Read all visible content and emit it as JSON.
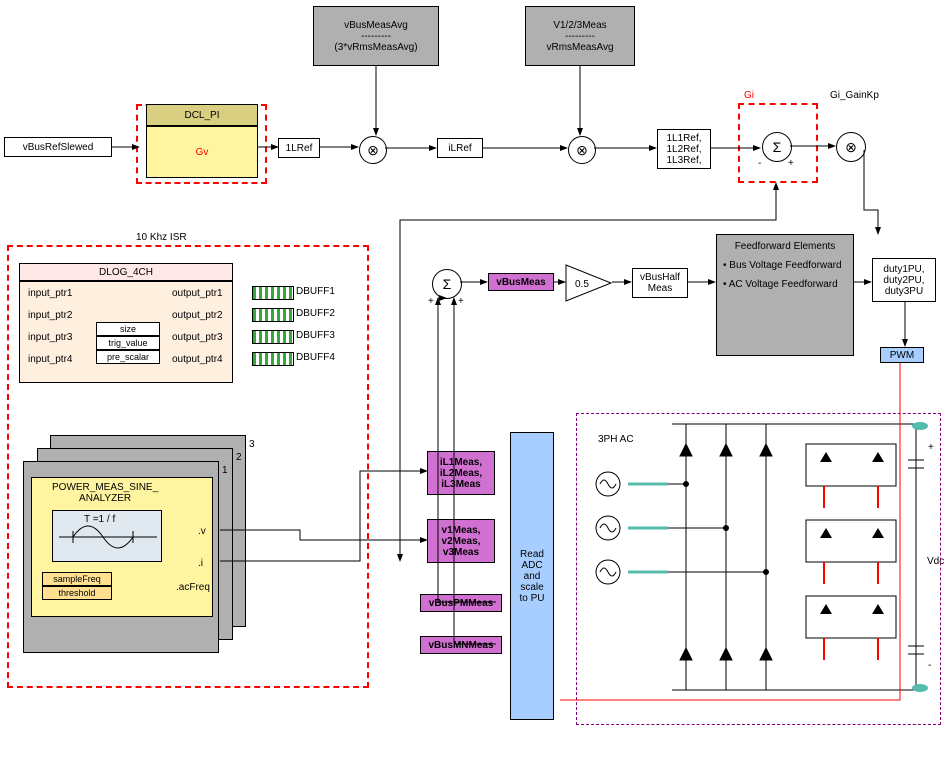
{
  "top": {
    "vBusRefSlewed": "vBusRefSlewed",
    "dclpi": "DCL_PI",
    "gv": "Gv",
    "gvLabel": "Gv",
    "gi": "Gi",
    "giGainKp": "Gi_GainKp",
    "ilref1": "1LRef",
    "ilref2": "iLRef",
    "ilroutMulti": "1L1Ref,\n1L2Ref,\n1L3Ref,",
    "vBusMeasAvg_top": "vBusMeasAvg",
    "vBusMeasAvg_dash": "---------",
    "vBusMeasAvg_bottom": "(3*vRmsMeasAvg)",
    "v123_top": "V1/2/3Meas",
    "v123_dash": "---------",
    "v123_bottom": "vRmsMeasAvg"
  },
  "mid": {
    "vBusMeas": "vBusMeas",
    "gain": "0.5",
    "vBusHalf": "vBusHalf\nMeas",
    "feedforward_title": "Feedforward Elements",
    "ff1": "• Bus Voltage Feedforward",
    "ff2": "• AC Voltage Feedforward",
    "duty": "duty1PU,\nduty2PU,\nduty3PU",
    "pwm": "PWM"
  },
  "isr": {
    "title": "10 Khz ISR",
    "dlog": "DLOG_4CH",
    "in": [
      "input_ptr1",
      "input_ptr2",
      "input_ptr3",
      "input_ptr4"
    ],
    "out": [
      "output_ptr1",
      "output_ptr2",
      "output_ptr3",
      "output_ptr4"
    ],
    "mid": [
      "size",
      "trig_value",
      "pre_scalar"
    ],
    "dbuff": [
      "DBUFF1",
      "DBUFF2",
      "DBUFF3",
      "DBUFF4"
    ],
    "pma": "POWER_MEAS_SINE_\nANALYZER",
    "tformula": "T =1 / f",
    "vlabel": ".v",
    "ilabel": ".i",
    "acf": ".acFreq",
    "sf": "sampleFreq",
    "th": "threshold",
    "stack": [
      "3",
      "2",
      "1"
    ]
  },
  "adc": {
    "il": "iL1Meas,\niL2Meas,\niL3Meas",
    "v": "v1Meas,\nv2Meas,\nv3Meas",
    "pm": "vBusPMMeas",
    "mn": "vBusMNMeas",
    "read": "Read ADC and scale to PU",
    "threeph": "3PH AC",
    "vdc": "Vdc"
  }
}
